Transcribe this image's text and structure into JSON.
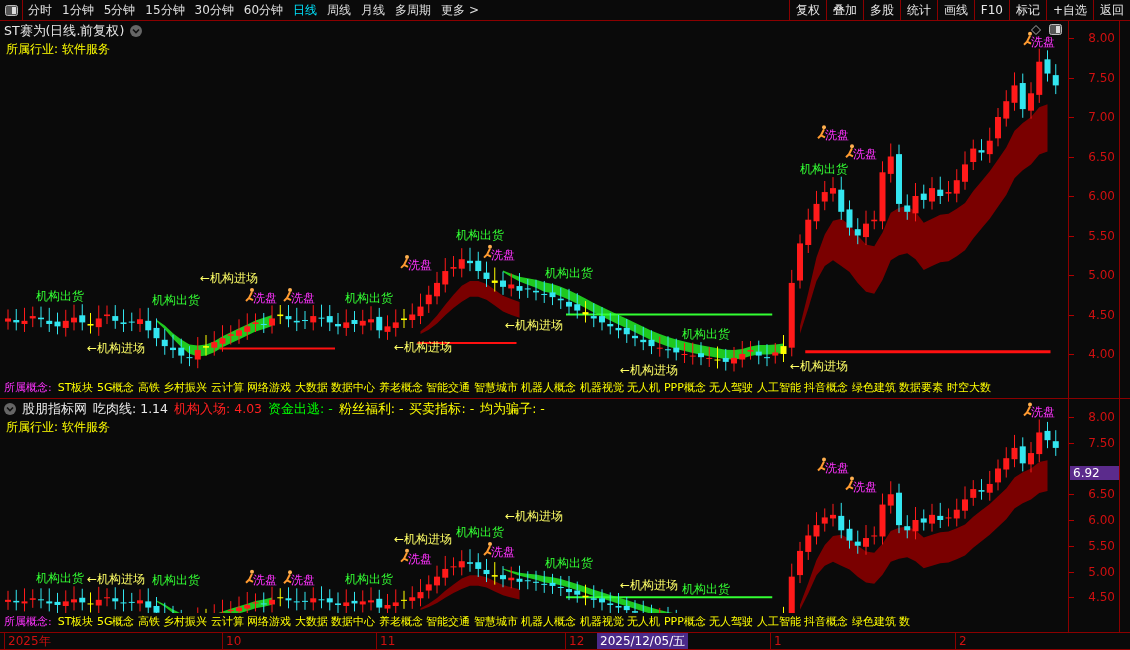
{
  "toolbar": {
    "periods": [
      {
        "label": "分时",
        "selected": false
      },
      {
        "label": "1分钟",
        "selected": false
      },
      {
        "label": "5分钟",
        "selected": false
      },
      {
        "label": "15分钟",
        "selected": false
      },
      {
        "label": "30分钟",
        "selected": false
      },
      {
        "label": "60分钟",
        "selected": false
      },
      {
        "label": "日线",
        "selected": true
      },
      {
        "label": "周线",
        "selected": false
      },
      {
        "label": "月线",
        "selected": false
      },
      {
        "label": "多周期",
        "selected": false
      },
      {
        "label": "更多 >",
        "selected": false
      }
    ],
    "buttons": [
      "复权",
      "叠加",
      "多股",
      "统计",
      "画线",
      "F10",
      "标记",
      "+自选",
      "返回"
    ]
  },
  "main_panel": {
    "title": "ST赛为(日线.前复权)",
    "industry": "所属行业:  软件服务",
    "concepts": {
      "label": "所属概念:",
      "value": "ST板块 5G概念 高铁 乡村振兴 云计算 网络游戏 大数据 数据中心 养老概念 智能交通 智慧城市 机器人概念 机器视觉 无人机 PPP概念 无人驾驶 人工智能 抖音概念 绿色建筑 数据要素 时空大数"
    },
    "axis": [
      "8.00",
      "7.50",
      "7.00",
      "6.50",
      "6.00",
      "5.50",
      "5.00",
      "4.50",
      "4.00"
    ],
    "signals": [
      {
        "kind": "washout",
        "text": "洗盘"
      },
      {
        "kind": "washout",
        "text": "洗盘"
      },
      {
        "kind": "washout",
        "text": "洗盘"
      },
      {
        "kind": "washout",
        "text": "洗盘"
      },
      {
        "kind": "exit",
        "text": "机构出货"
      },
      {
        "kind": "washout",
        "text": "洗盘"
      },
      {
        "kind": "exit",
        "text": "机构出货"
      },
      {
        "kind": "exit",
        "text": "机构出货"
      },
      {
        "kind": "washout",
        "text": "洗盘"
      },
      {
        "kind": "washout",
        "text": "洗盘"
      },
      {
        "kind": "exit",
        "text": "机构出货"
      },
      {
        "kind": "exit",
        "text": "机构出货"
      },
      {
        "kind": "exit",
        "text": "机构出货"
      },
      {
        "kind": "entry",
        "text": "←机构进场"
      },
      {
        "kind": "entry",
        "text": "←机构进场"
      },
      {
        "kind": "entry",
        "text": "←机构进场"
      },
      {
        "kind": "entry",
        "text": "←机构进场"
      },
      {
        "kind": "entry",
        "text": "←机构进场"
      },
      {
        "kind": "exit",
        "text": "机构出货"
      },
      {
        "kind": "entry",
        "text": "←机构进场"
      }
    ]
  },
  "indicator_panel": {
    "name": "股朋指标网",
    "readings": [
      {
        "text": "吃肉线: 1.14",
        "color": "#e8e8e8"
      },
      {
        "text": "机构入场: 4.03",
        "color": "#ff2020"
      },
      {
        "text": "资金出逃: -",
        "color": "#00ff00"
      },
      {
        "text": "粉丝福利: -",
        "color": "#ffff00"
      },
      {
        "text": "买卖指标: -",
        "color": "#ffff00"
      },
      {
        "text": "均为骗子: -",
        "color": "#ffff00"
      }
    ],
    "industry": "所属行业:  软件服务",
    "concepts": {
      "label": "所属概念:",
      "value": "ST板块 5G概念 高铁 乡村振兴 云计算 网络游戏 大数据 数据中心 养老概念 智能交通 智慧城市 机器人概念 机器视觉 无人机 PPP概念 无人驾驶 人工智能 抖音概念 绿色建筑 数"
    },
    "axis": [
      "8.00",
      "7.50",
      "6.50",
      "6.00",
      "5.50",
      "5.00",
      "4.50"
    ],
    "price_tag": "6.92",
    "signals": [
      {
        "kind": "washout",
        "text": "洗盘"
      },
      {
        "kind": "washout",
        "text": "洗盘"
      },
      {
        "kind": "washout",
        "text": "洗盘"
      },
      {
        "kind": "washout",
        "text": "洗盘"
      },
      {
        "kind": "exit",
        "text": "机构出货"
      },
      {
        "kind": "washout",
        "text": "洗盘"
      },
      {
        "kind": "exit",
        "text": "机构出货"
      },
      {
        "kind": "exit",
        "text": "机构出货"
      },
      {
        "kind": "washout",
        "text": "洗盘"
      },
      {
        "kind": "washout",
        "text": "洗盘"
      },
      {
        "kind": "exit",
        "text": "机构出货"
      },
      {
        "kind": "exit",
        "text": "机构出货"
      },
      {
        "kind": "exit",
        "text": "机构出货"
      },
      {
        "kind": "entry",
        "text": "←机构进场"
      },
      {
        "kind": "entry",
        "text": "←机构进场"
      },
      {
        "kind": "entry",
        "text": "←机构进场"
      },
      {
        "kind": "entry",
        "text": "←机构进场"
      }
    ]
  },
  "date_axis": [
    {
      "kind": "month",
      "text": "2025年"
    },
    {
      "kind": "month",
      "text": "10"
    },
    {
      "kind": "month",
      "text": "11"
    },
    {
      "kind": "month",
      "text": "12"
    },
    {
      "kind": "cursor",
      "text": "2025/12/05/五"
    },
    {
      "kind": "month",
      "text": "1"
    },
    {
      "kind": "month",
      "text": "2"
    }
  ]
}
